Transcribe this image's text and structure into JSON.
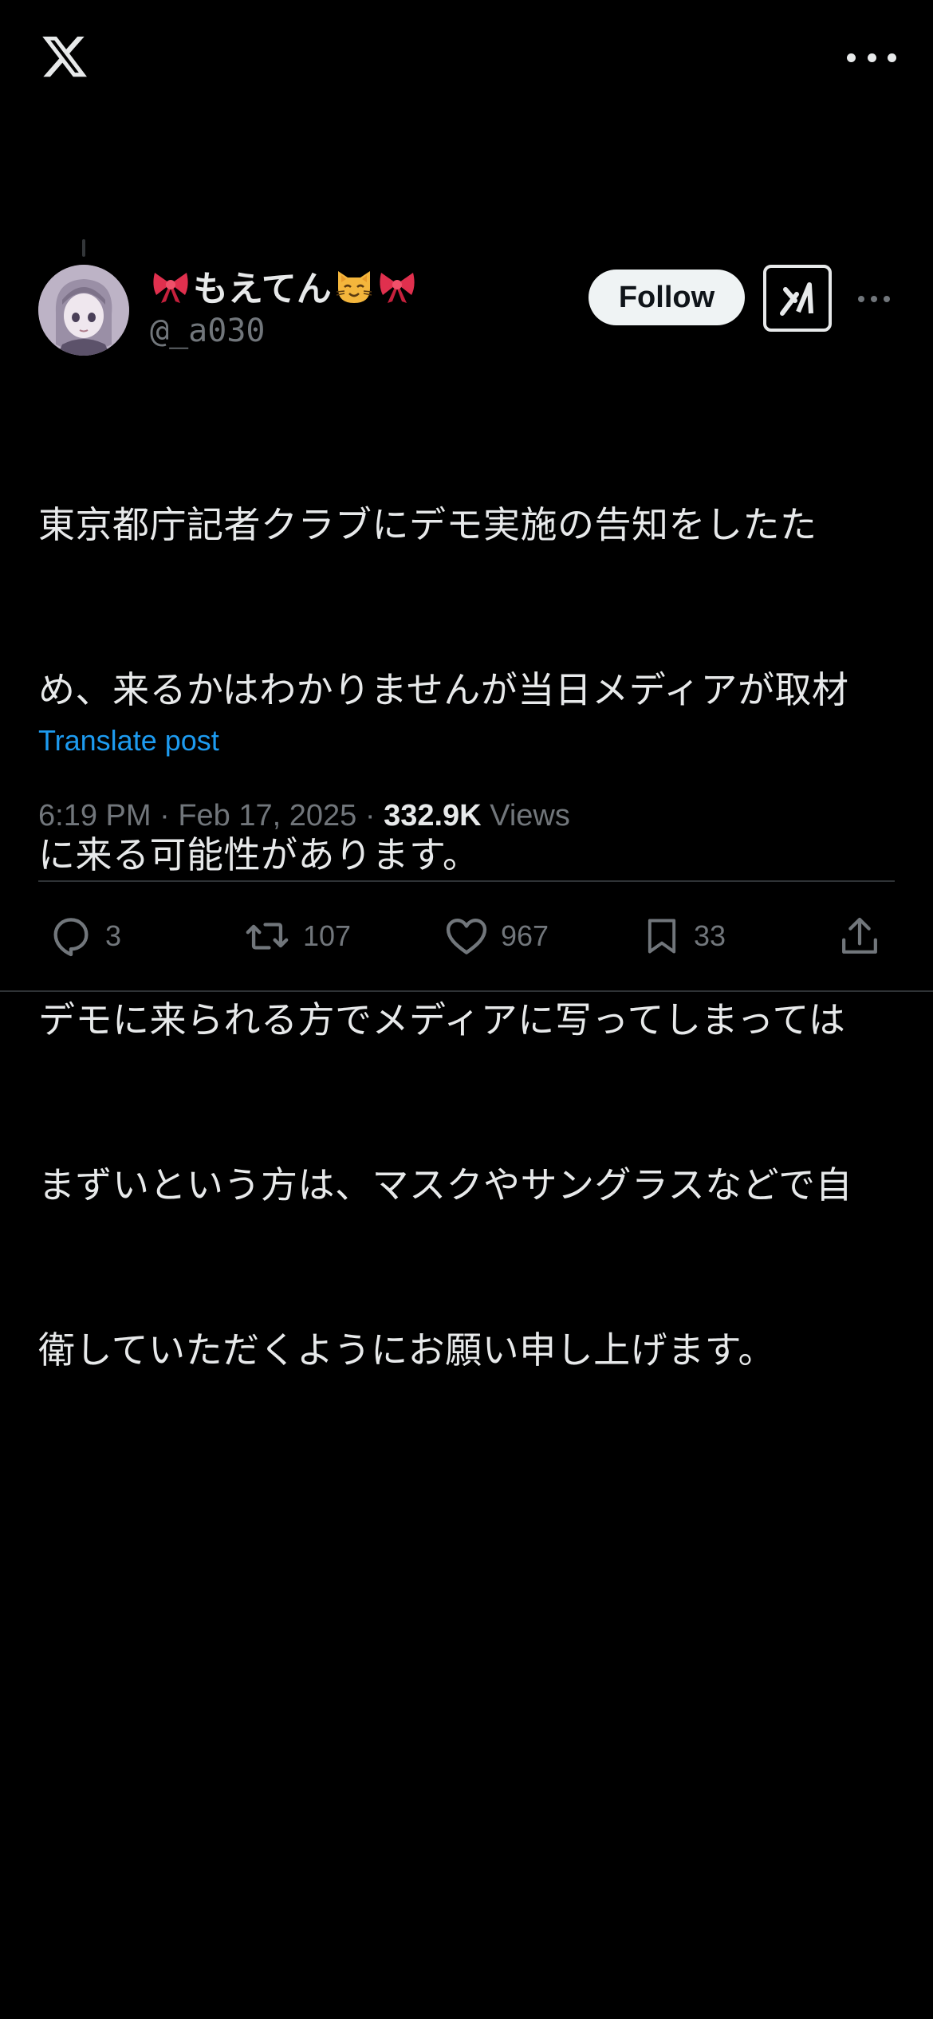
{
  "app": {
    "logo_icon": "x-logo-icon",
    "more_icon": "more-horizontal-icon"
  },
  "post": {
    "author": {
      "display_name": "もえてん",
      "name_emoji_left": "ribbon-emoji",
      "name_emoji_right_1": "cat-face-emoji",
      "name_emoji_right_2": "ribbon-emoji",
      "handle": "@_a030"
    },
    "follow_label": "Follow",
    "grok_icon": "grok-icon",
    "text": "東京都庁記者クラブにデモ実施の告知をしたため、来るかはわかりませんが当日メディアが取材に来る可能性があります。\nデモに来られる方でメディアに写ってしまってはまずいという方は、マスクやサングラスなどで自衛していただくようにお願い申し上げます。",
    "text_lines": [
      "東京都庁記者クラブにデモ実施の告知をしたた",
      "め、来るかはわかりませんが当日メディアが取材",
      "に来る可能性があります。",
      "デモに来られる方でメディアに写ってしまっては",
      "まずいという方は、マスクやサングラスなどで自",
      "衛していただくようにお願い申し上げます。"
    ],
    "translate_label": "Translate post",
    "time": "6:19 PM",
    "date": "Feb 17, 2025",
    "separator": "·",
    "views_count": "332.9K",
    "views_label": "Views",
    "stats": {
      "replies": "3",
      "reposts": "107",
      "likes": "967",
      "bookmarks": "33"
    }
  },
  "colors": {
    "background": "#000000",
    "text_primary": "#e7e9ea",
    "text_secondary": "#71767b",
    "link": "#1d9bf0",
    "divider": "#2f3336",
    "follow_bg": "#eff3f4"
  }
}
